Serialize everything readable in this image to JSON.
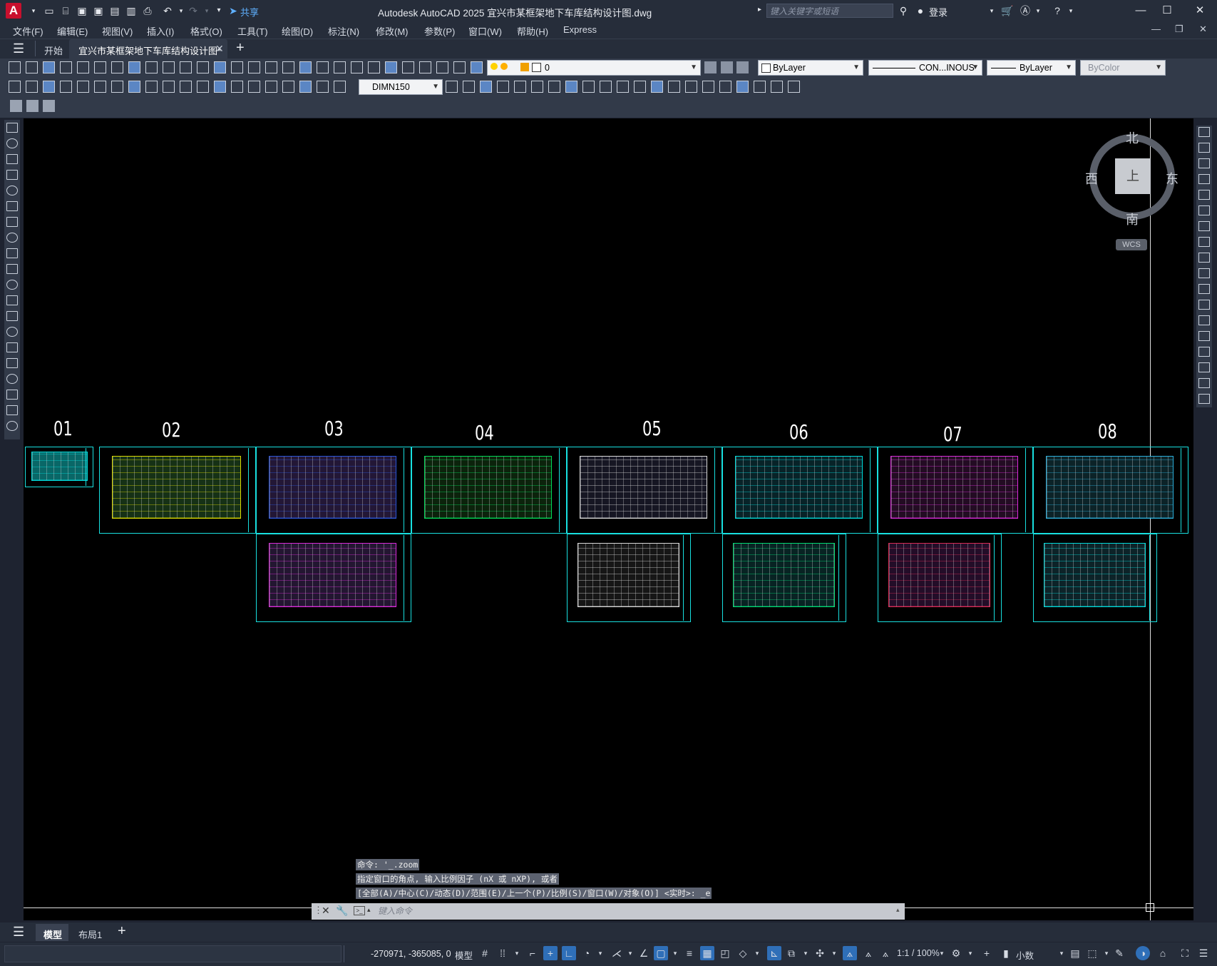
{
  "app": {
    "logo_text": "A",
    "window_title": "Autodesk AutoCAD 2025    宜兴市某框架地下车库结构设计图.dwg",
    "share_label": "共享",
    "search_placeholder": "键入关键字或短语",
    "login_label": "登录",
    "colors": {
      "title_bar": "#262d3a",
      "toolbar": "#323a49",
      "canvas": "#000000",
      "sheet_frame": "#18e0e0",
      "logo": "#c8102e",
      "accent": "#2f6fb8"
    }
  },
  "menu": [
    "文件(F)",
    "编辑(E)",
    "视图(V)",
    "插入(I)",
    "格式(O)",
    "工具(T)",
    "绘图(D)",
    "标注(N)",
    "修改(M)",
    "参数(P)",
    "窗口(W)",
    "帮助(H)",
    "Express"
  ],
  "file_tabs": {
    "start": "开始",
    "active_doc": "宜兴市某框架地下车库结构设计图*"
  },
  "properties": {
    "layer": "0",
    "color": "ByLayer",
    "linetype": "CON...INOUS",
    "lineweight": "ByLayer",
    "plotstyle": "ByColor",
    "dim_style": "DIMN150"
  },
  "viewcube": {
    "north": "北",
    "south": "南",
    "east": "东",
    "west": "西",
    "face": "上",
    "ucs": "WCS"
  },
  "sheets": [
    "01",
    "02",
    "03",
    "04",
    "05",
    "06",
    "07",
    "08"
  ],
  "command": {
    "history": [
      "命令: '_.zoom",
      "指定窗口的角点, 输入比例因子 (nX 或 nXP), 或者",
      "[全部(A)/中心(C)/动态(D)/范围(E)/上一个(P)/比例(S)/窗口(W)/对象(O)] <实时>: _e"
    ],
    "placeholder": "键入命令"
  },
  "layout_tabs": [
    "模型",
    "布局1"
  ],
  "status": {
    "coords": "-270971, -365085, 0",
    "space": "模型",
    "scale": "1:1 / 100%",
    "units": "小数"
  },
  "icons": [
    "new-icon",
    "open-icon",
    "save-icon",
    "plot-icon",
    "undo-icon",
    "redo-icon",
    "pan-icon",
    "zoom-icon",
    "layer-icon",
    "line-icon",
    "circle-icon",
    "arc-icon",
    "move-icon",
    "rotate-icon",
    "trim-icon",
    "grid-icon",
    "snap-icon",
    "gear-icon",
    "plus-icon",
    "close-icon",
    "wrench-icon",
    "menu-icon",
    "search-icon",
    "user-icon",
    "cart-icon",
    "help-icon"
  ]
}
